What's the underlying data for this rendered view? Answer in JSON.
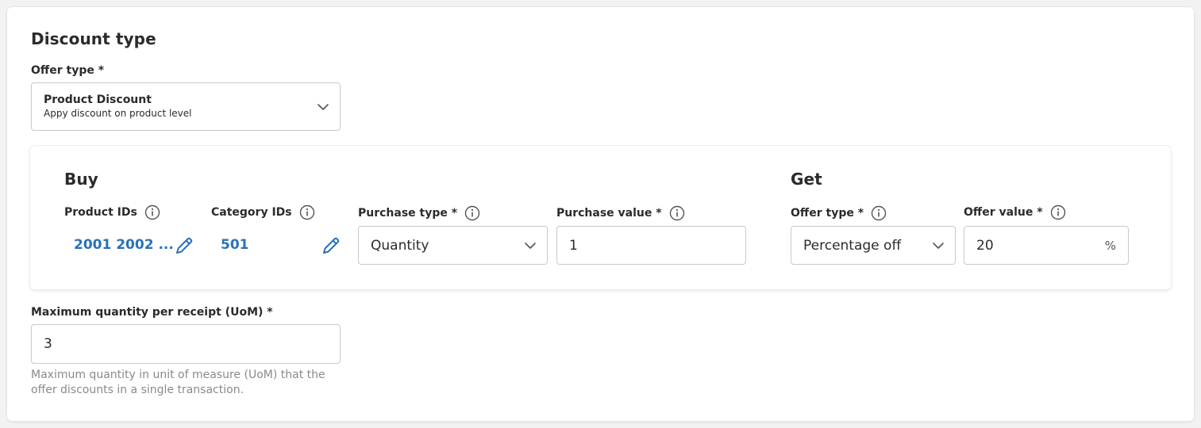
{
  "discount": {
    "title": "Discount type",
    "offer_type_label": "Offer type *",
    "offer_type_value": "Product Discount",
    "offer_type_desc": "Appy discount on product level"
  },
  "buy": {
    "title": "Buy",
    "product_ids_label": "Product IDs",
    "product_ids_value": "2001 2002 ...",
    "category_ids_label": "Category IDs",
    "category_ids_value": "501",
    "purchase_type_label": "Purchase type *",
    "purchase_type_value": "Quantity",
    "purchase_value_label": "Purchase value *",
    "purchase_value_value": "1"
  },
  "get": {
    "title": "Get",
    "offer_type_label": "Offer type *",
    "offer_type_value": "Percentage off",
    "offer_value_label": "Offer value *",
    "offer_value_value": "20",
    "offer_value_unit": "%"
  },
  "max_qty": {
    "label": "Maximum quantity per receipt (UoM) *",
    "value": "3",
    "help": "Maximum quantity in unit of measure (UoM) that the offer discounts in a single transaction."
  },
  "colors": {
    "link": "#2a72b8",
    "text": "#2b2b2b",
    "muted": "#8a8a8a",
    "border": "#c9c9c9"
  },
  "icons": [
    "info-icon",
    "pencil-icon",
    "chevron-down-icon"
  ]
}
